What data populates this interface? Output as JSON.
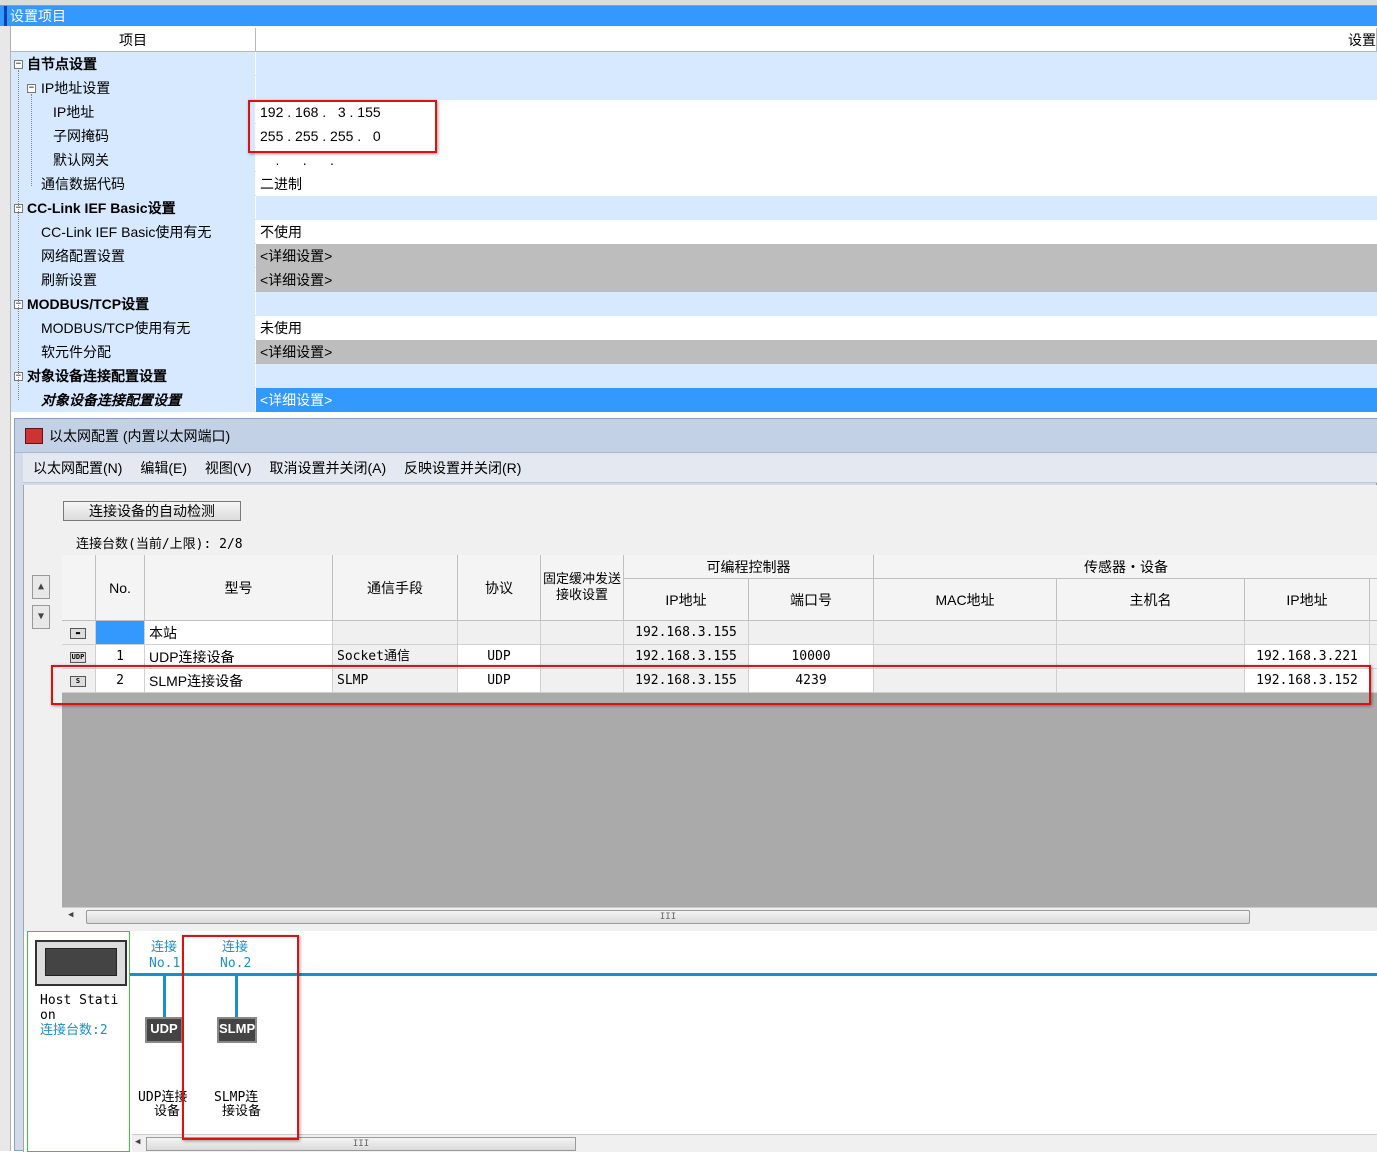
{
  "settings": {
    "title": "设置项目",
    "col_item": "项目",
    "col_setting": "设置",
    "rows": [
      {
        "label": "自节点设置",
        "value": ""
      },
      {
        "label": "IP地址设置",
        "value": ""
      },
      {
        "label": "IP地址",
        "value": "192 . 168 .   3 . 155"
      },
      {
        "label": "子网掩码",
        "value": "255 . 255 . 255 .   0"
      },
      {
        "label": "默认网关",
        "value": "    .      .      ."
      },
      {
        "label": "通信数据代码",
        "value": "二进制"
      },
      {
        "label": "CC-Link IEF Basic设置",
        "value": ""
      },
      {
        "label": "CC-Link IEF Basic使用有无",
        "value": "不使用"
      },
      {
        "label": "网络配置设置",
        "value": "<详细设置>"
      },
      {
        "label": "刷新设置",
        "value": "<详细设置>"
      },
      {
        "label": "MODBUS/TCP设置",
        "value": ""
      },
      {
        "label": "MODBUS/TCP使用有无",
        "value": "未使用"
      },
      {
        "label": "软元件分配",
        "value": "<详细设置>"
      },
      {
        "label": "对象设备连接配置设置",
        "value": ""
      },
      {
        "label": "对象设备连接配置设置",
        "value": "<详细设置>"
      }
    ]
  },
  "ethernet": {
    "window_title": "以太网配置 (内置以太网端口)",
    "menu": [
      "以太网配置(N)",
      "编辑(E)",
      "视图(V)",
      "取消设置并关闭(A)",
      "反映设置并关闭(R)"
    ],
    "auto_detect_button": "连接设备的自动检测",
    "count_label": "连接台数(当前/上限):  2/8",
    "table": {
      "headers": {
        "no": "No.",
        "model": "型号",
        "comm": "通信手段",
        "protocol": "协议",
        "fixed_buffer": "固定缓冲发送接收设置",
        "plc_group": "可编程控制器",
        "plc_ip": "IP地址",
        "plc_port": "端口号",
        "sensor_group": "传感器・设备",
        "mac": "MAC地址",
        "host": "主机名",
        "sensor_ip": "IP地址"
      },
      "rows": [
        {
          "icon": "host-station-icon",
          "no": "",
          "model": "本站",
          "comm": "",
          "protocol": "",
          "fixed": "",
          "plc_ip": "192.168.3.155",
          "plc_port": "",
          "mac": "",
          "host": "",
          "sensor_ip": ""
        },
        {
          "icon": "udp-icon",
          "no": "1",
          "model": "UDP连接设备",
          "comm": "Socket通信",
          "protocol": "UDP",
          "fixed": "",
          "plc_ip": "192.168.3.155",
          "plc_port": "10000",
          "mac": "",
          "host": "",
          "sensor_ip": "192.168.3.221"
        },
        {
          "icon": "slmp-icon",
          "no": "2",
          "model": "SLMP连接设备",
          "comm": "SLMP",
          "protocol": "UDP",
          "fixed": "",
          "plc_ip": "192.168.3.155",
          "plc_port": "4239",
          "mac": "",
          "host": "",
          "sensor_ip": "192.168.3.152"
        }
      ]
    },
    "diagram": {
      "host_label_line1": "Host Stati",
      "host_label_line2": "on",
      "host_count": "连接台数:2",
      "conn1_line1": "连接",
      "conn1_line2": "No.1",
      "conn2_line1": "连接",
      "conn2_line2": "No.2",
      "dev1_icon": "UDP",
      "dev2_icon": "SLMP",
      "dev1_label_line1": "UDP连接",
      "dev1_label_line2": "设备",
      "dev2_label_line1": "SLMP连",
      "dev2_label_line2": "接设备"
    },
    "scroll_grip": "III"
  }
}
